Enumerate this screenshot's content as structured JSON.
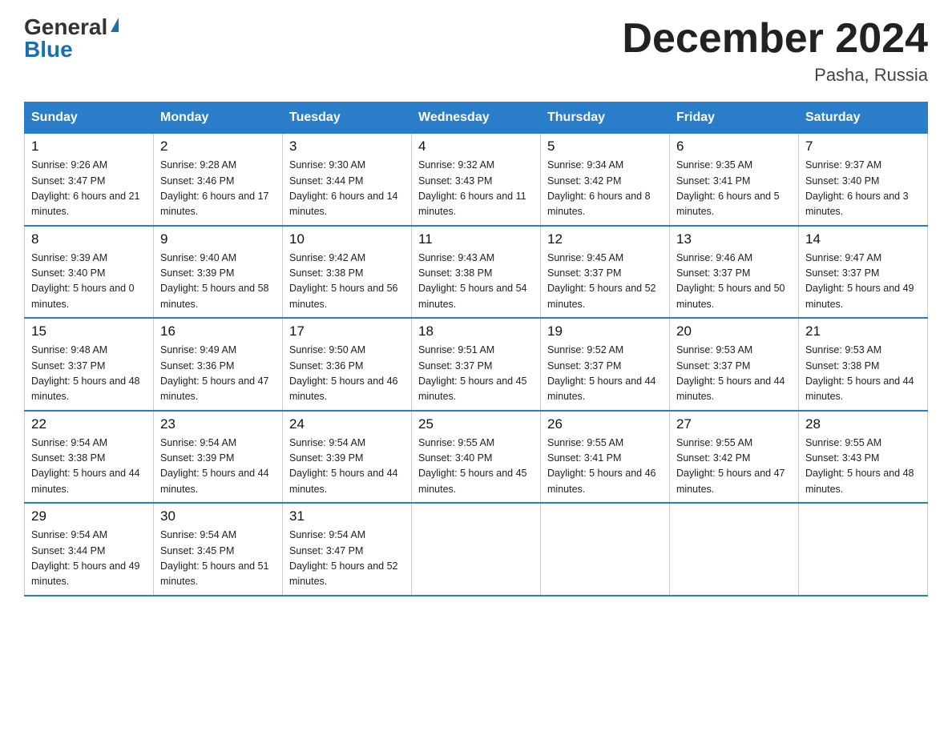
{
  "header": {
    "logo_general": "General",
    "logo_blue": "Blue",
    "month_title": "December 2024",
    "location": "Pasha, Russia"
  },
  "days_of_week": [
    "Sunday",
    "Monday",
    "Tuesday",
    "Wednesday",
    "Thursday",
    "Friday",
    "Saturday"
  ],
  "weeks": [
    [
      {
        "day": "1",
        "sunrise": "9:26 AM",
        "sunset": "3:47 PM",
        "daylight": "6 hours and 21 minutes."
      },
      {
        "day": "2",
        "sunrise": "9:28 AM",
        "sunset": "3:46 PM",
        "daylight": "6 hours and 17 minutes."
      },
      {
        "day": "3",
        "sunrise": "9:30 AM",
        "sunset": "3:44 PM",
        "daylight": "6 hours and 14 minutes."
      },
      {
        "day": "4",
        "sunrise": "9:32 AM",
        "sunset": "3:43 PM",
        "daylight": "6 hours and 11 minutes."
      },
      {
        "day": "5",
        "sunrise": "9:34 AM",
        "sunset": "3:42 PM",
        "daylight": "6 hours and 8 minutes."
      },
      {
        "day": "6",
        "sunrise": "9:35 AM",
        "sunset": "3:41 PM",
        "daylight": "6 hours and 5 minutes."
      },
      {
        "day": "7",
        "sunrise": "9:37 AM",
        "sunset": "3:40 PM",
        "daylight": "6 hours and 3 minutes."
      }
    ],
    [
      {
        "day": "8",
        "sunrise": "9:39 AM",
        "sunset": "3:40 PM",
        "daylight": "5 hours and 0 minutes."
      },
      {
        "day": "9",
        "sunrise": "9:40 AM",
        "sunset": "3:39 PM",
        "daylight": "5 hours and 58 minutes."
      },
      {
        "day": "10",
        "sunrise": "9:42 AM",
        "sunset": "3:38 PM",
        "daylight": "5 hours and 56 minutes."
      },
      {
        "day": "11",
        "sunrise": "9:43 AM",
        "sunset": "3:38 PM",
        "daylight": "5 hours and 54 minutes."
      },
      {
        "day": "12",
        "sunrise": "9:45 AM",
        "sunset": "3:37 PM",
        "daylight": "5 hours and 52 minutes."
      },
      {
        "day": "13",
        "sunrise": "9:46 AM",
        "sunset": "3:37 PM",
        "daylight": "5 hours and 50 minutes."
      },
      {
        "day": "14",
        "sunrise": "9:47 AM",
        "sunset": "3:37 PM",
        "daylight": "5 hours and 49 minutes."
      }
    ],
    [
      {
        "day": "15",
        "sunrise": "9:48 AM",
        "sunset": "3:37 PM",
        "daylight": "5 hours and 48 minutes."
      },
      {
        "day": "16",
        "sunrise": "9:49 AM",
        "sunset": "3:36 PM",
        "daylight": "5 hours and 47 minutes."
      },
      {
        "day": "17",
        "sunrise": "9:50 AM",
        "sunset": "3:36 PM",
        "daylight": "5 hours and 46 minutes."
      },
      {
        "day": "18",
        "sunrise": "9:51 AM",
        "sunset": "3:37 PM",
        "daylight": "5 hours and 45 minutes."
      },
      {
        "day": "19",
        "sunrise": "9:52 AM",
        "sunset": "3:37 PM",
        "daylight": "5 hours and 44 minutes."
      },
      {
        "day": "20",
        "sunrise": "9:53 AM",
        "sunset": "3:37 PM",
        "daylight": "5 hours and 44 minutes."
      },
      {
        "day": "21",
        "sunrise": "9:53 AM",
        "sunset": "3:38 PM",
        "daylight": "5 hours and 44 minutes."
      }
    ],
    [
      {
        "day": "22",
        "sunrise": "9:54 AM",
        "sunset": "3:38 PM",
        "daylight": "5 hours and 44 minutes."
      },
      {
        "day": "23",
        "sunrise": "9:54 AM",
        "sunset": "3:39 PM",
        "daylight": "5 hours and 44 minutes."
      },
      {
        "day": "24",
        "sunrise": "9:54 AM",
        "sunset": "3:39 PM",
        "daylight": "5 hours and 44 minutes."
      },
      {
        "day": "25",
        "sunrise": "9:55 AM",
        "sunset": "3:40 PM",
        "daylight": "5 hours and 45 minutes."
      },
      {
        "day": "26",
        "sunrise": "9:55 AM",
        "sunset": "3:41 PM",
        "daylight": "5 hours and 46 minutes."
      },
      {
        "day": "27",
        "sunrise": "9:55 AM",
        "sunset": "3:42 PM",
        "daylight": "5 hours and 47 minutes."
      },
      {
        "day": "28",
        "sunrise": "9:55 AM",
        "sunset": "3:43 PM",
        "daylight": "5 hours and 48 minutes."
      }
    ],
    [
      {
        "day": "29",
        "sunrise": "9:54 AM",
        "sunset": "3:44 PM",
        "daylight": "5 hours and 49 minutes."
      },
      {
        "day": "30",
        "sunrise": "9:54 AM",
        "sunset": "3:45 PM",
        "daylight": "5 hours and 51 minutes."
      },
      {
        "day": "31",
        "sunrise": "9:54 AM",
        "sunset": "3:47 PM",
        "daylight": "5 hours and 52 minutes."
      },
      null,
      null,
      null,
      null
    ]
  ]
}
